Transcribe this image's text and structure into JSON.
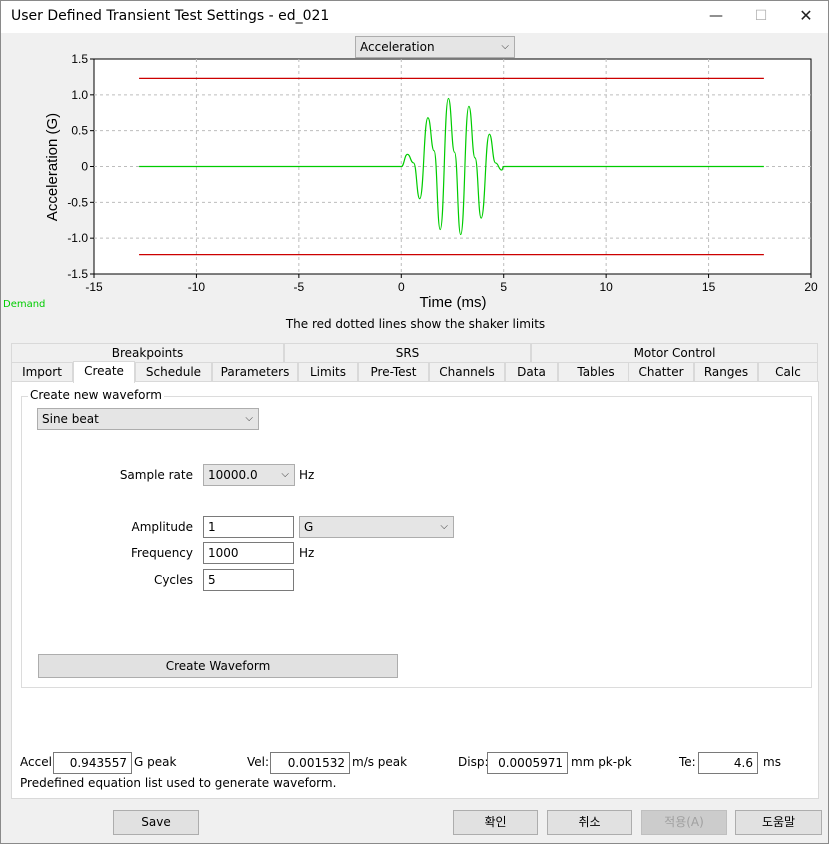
{
  "window": {
    "title": "User Defined Transient Test Settings - ed_021",
    "controls": {
      "minimize": "—",
      "maximize": "☐",
      "close": "✕"
    }
  },
  "chart_selector": {
    "value": "Acceleration"
  },
  "chart_data": {
    "type": "line",
    "title": "",
    "xlabel": "Time (ms)",
    "ylabel": "Acceleration (G)",
    "xlim": [
      -15,
      20
    ],
    "ylim": [
      -1.5,
      1.5
    ],
    "x_ticks": [
      "-15",
      "-10",
      "-5",
      "0",
      "5",
      "10",
      "15",
      "20"
    ],
    "y_ticks": [
      "1.5",
      "1.0",
      "0.5",
      "0",
      "-0.5",
      "-1.0",
      "-1.5"
    ],
    "grid": true,
    "series": [
      {
        "name": "Demand",
        "color": "#00cc00",
        "x": [
          -12.8,
          0.0,
          0.3,
          0.6,
          0.9,
          1.3,
          1.6,
          1.9,
          2.3,
          2.6,
          2.9,
          3.3,
          3.6,
          3.9,
          4.3,
          4.6,
          4.9,
          5.0,
          17.7
        ],
        "y": [
          0,
          0,
          0.17,
          0.05,
          -0.45,
          0.68,
          0.22,
          -0.88,
          0.95,
          0.2,
          -0.95,
          0.84,
          0.12,
          -0.72,
          0.45,
          0.05,
          -0.05,
          0,
          0
        ]
      },
      {
        "name": "Upper limit",
        "color": "#cc0000",
        "x": [
          -12.8,
          17.7
        ],
        "y": [
          1.23,
          1.23
        ]
      },
      {
        "name": "Lower limit",
        "color": "#cc0000",
        "x": [
          -12.8,
          17.7
        ],
        "y": [
          -1.23,
          -1.23
        ]
      }
    ]
  },
  "demand_label": "Demand",
  "chart_note": "The red dotted lines show the shaker limits",
  "tabs": {
    "row1": [
      "Breakpoints",
      "SRS",
      "Motor Control"
    ],
    "row2": [
      "Import",
      "Create",
      "Schedule",
      "Parameters",
      "Limits",
      "Pre-Test",
      "Channels",
      "Data",
      "Tables",
      "Chatter",
      "Ranges",
      "Calc"
    ],
    "active": "Create"
  },
  "create": {
    "group_title": "Create new waveform",
    "waveform_type": "Sine beat",
    "sample_rate": {
      "label": "Sample rate",
      "value": "10000.0",
      "unit": "Hz"
    },
    "amplitude": {
      "label": "Amplitude",
      "value": "1",
      "unit": "G"
    },
    "frequency": {
      "label": "Frequency",
      "value": "1000",
      "unit": "Hz"
    },
    "cycles": {
      "label": "Cycles",
      "value": "5"
    },
    "create_button": "Create Waveform"
  },
  "summary": {
    "accel": {
      "label": "Accel:",
      "value": "0.943557",
      "unit": "G peak"
    },
    "vel": {
      "label": "Vel:",
      "value": "0.001532",
      "unit": "m/s peak"
    },
    "disp": {
      "label": "Disp:",
      "value": "0.0005971",
      "unit": "mm pk-pk"
    },
    "te": {
      "label": "Te:",
      "value": "4.6",
      "unit": "ms"
    }
  },
  "status_text": "Predefined equation list used to generate waveform.",
  "buttons": {
    "save": "Save",
    "ok": "확인",
    "cancel": "취소",
    "apply": "적용(A)",
    "help": "도움말"
  }
}
